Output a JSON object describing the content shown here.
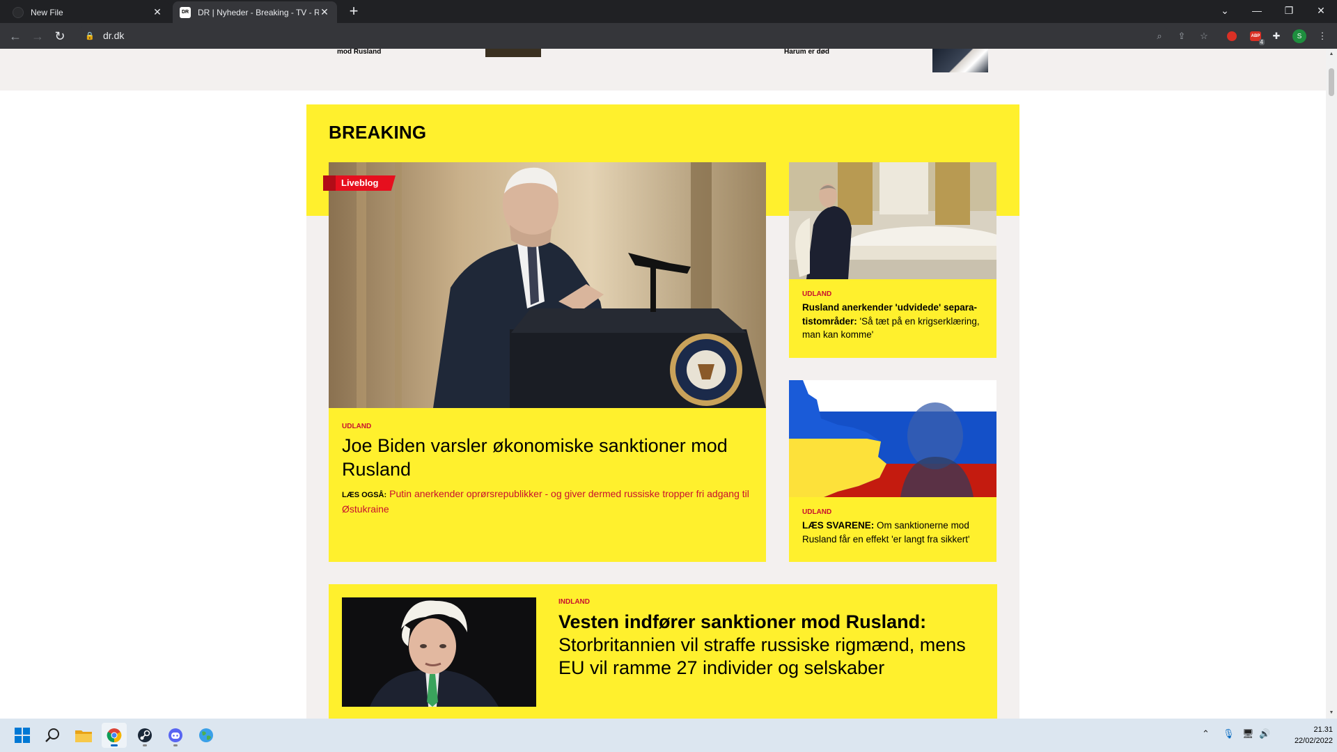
{
  "browser": {
    "tabs": [
      {
        "title": "New File"
      },
      {
        "title": "DR | Nyheder - Breaking - TV - Radio",
        "favicon_text": "DR"
      }
    ],
    "new_tab_label": "+",
    "url": "dr.dk",
    "profile_initial": "S",
    "extension_badge": "4"
  },
  "page": {
    "top_strip": {
      "left_text": "mod Rusland",
      "right_text": "Harum er død"
    },
    "section_title": "BREAKING",
    "main_story": {
      "badge": "Liveblog",
      "category": "UDLAND",
      "headline": "Joe Biden varsler økonomiske sanktioner mod Rusland",
      "read_also_label": "LÆS OGSÅ:",
      "read_also_text": "Putin anerkender oprørsrepublikker - og giver dermed russiske tropper fri adgang til Østukraine"
    },
    "side_stories": [
      {
        "category": "UDLAND",
        "bold": "Rusland anerkender 'udvidede' separa­tistområder:",
        "text": " 'Så tæt på en krigserklæ­ring, man kan komme'"
      },
      {
        "category": "UDLAND",
        "bold": "LÆS SVARENE:",
        "text": " Om sanktionerne mod Rusland får en effekt 'er langt fra sikkert'"
      }
    ],
    "bottom_story": {
      "category": "INDLAND",
      "bold": "Vesten indfører sanktioner mod Rusland:",
      "text": " Storbritannien vil straffe russiske rigmænd, mens EU vil ramme 27 individer og selskaber"
    }
  },
  "taskbar": {
    "time": "21.31",
    "date": "22/02/2022"
  },
  "colors": {
    "breaking_yellow": "#fff02d",
    "dr_red": "#c8102e",
    "liveblog_red": "#e60f1e"
  }
}
